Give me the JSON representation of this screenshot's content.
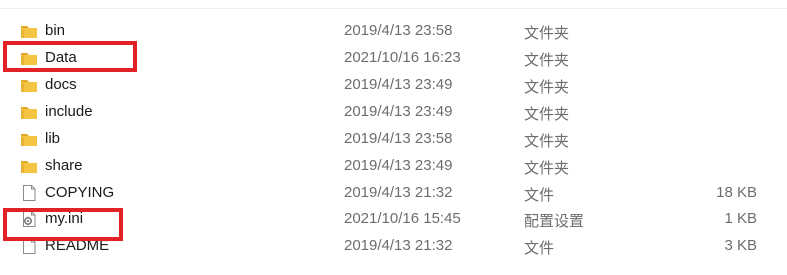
{
  "files": [
    {
      "icon": "folder-icon",
      "name": "bin",
      "date": "2019/4/13 23:58",
      "type": "文件夹",
      "size": ""
    },
    {
      "icon": "folder-icon",
      "name": "Data",
      "date": "2021/10/16 16:23",
      "type": "文件夹",
      "size": ""
    },
    {
      "icon": "folder-icon",
      "name": "docs",
      "date": "2019/4/13 23:49",
      "type": "文件夹",
      "size": ""
    },
    {
      "icon": "folder-icon",
      "name": "include",
      "date": "2019/4/13 23:49",
      "type": "文件夹",
      "size": ""
    },
    {
      "icon": "folder-icon",
      "name": "lib",
      "date": "2019/4/13 23:58",
      "type": "文件夹",
      "size": ""
    },
    {
      "icon": "folder-icon",
      "name": "share",
      "date": "2019/4/13 23:49",
      "type": "文件夹",
      "size": ""
    },
    {
      "icon": "document-icon",
      "name": "COPYING",
      "date": "2019/4/13 21:32",
      "type": "文件",
      "size": "18 KB"
    },
    {
      "icon": "settings-file-icon",
      "name": "my.ini",
      "date": "2021/10/16 15:45",
      "type": "配置设置",
      "size": "1 KB"
    },
    {
      "icon": "document-icon",
      "name": "README",
      "date": "2019/4/13 21:32",
      "type": "文件",
      "size": "3 KB"
    }
  ],
  "colors": {
    "folder": "#f4c542",
    "folder_dark": "#e0a92a",
    "highlight": "#e32228",
    "secondary_text": "#6d6d6d"
  }
}
